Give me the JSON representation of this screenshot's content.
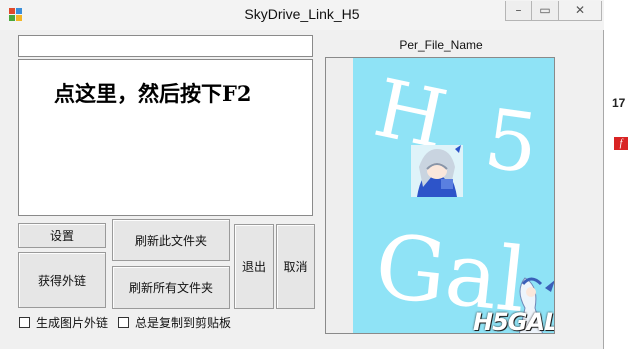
{
  "window": {
    "title": "SkyDrive_Link_H5",
    "min_label": "–",
    "max_label": "▭",
    "close_label": "✕"
  },
  "path_input": {
    "value": ""
  },
  "hint": {
    "text": "点这里，然后按下F2"
  },
  "buttons": {
    "settings": "设置",
    "refresh_folder": "刷新此文件夹",
    "get_link": "获得外链",
    "refresh_all": "刷新所有文件夹",
    "exit": "退出",
    "cancel": "取消"
  },
  "checkboxes": [
    {
      "label": "生成图片外链",
      "checked": false
    },
    {
      "label": "总是复制到剪贴板",
      "checked": false
    }
  ],
  "preview": {
    "label": "Per_File_Name",
    "logo_text": "H5GAL",
    "image_text_top": "H  5",
    "image_text_bottom": "Gal"
  },
  "background": {
    "number": "17",
    "flash_icon": "flash-icon"
  },
  "colors": {
    "preview_bg": "#8fe3f6",
    "window_bg": "#f0f0f0"
  }
}
